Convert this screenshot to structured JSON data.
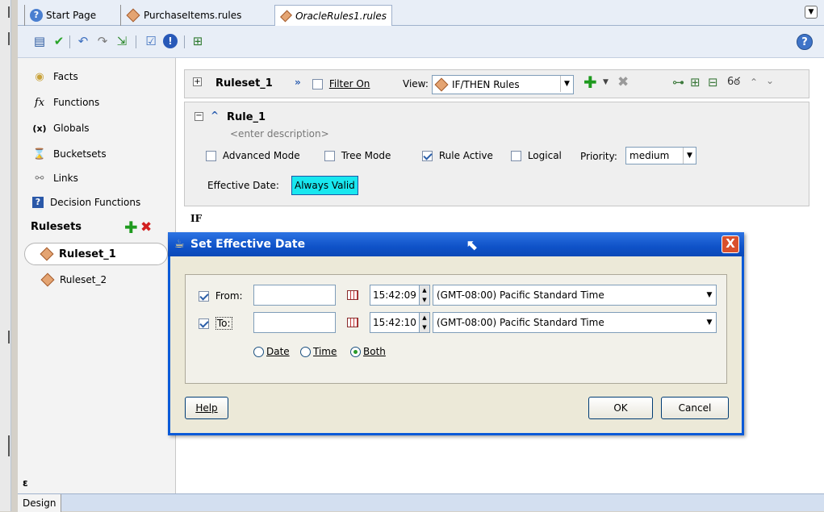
{
  "tabs": [
    {
      "label": "Start Page"
    },
    {
      "label": "PurchaseItems.rules"
    },
    {
      "label": "OracleRules1.rules"
    }
  ],
  "toolbar": {
    "icons": [
      "book-icon",
      "check-icon",
      "undo-icon",
      "redo-icon",
      "import-icon",
      "validate-icon",
      "info-icon",
      "tree-icon"
    ],
    "help_label": "?"
  },
  "navigator": {
    "items": [
      {
        "label": "Facts",
        "icon": "facts-icon"
      },
      {
        "label": "Functions",
        "icon": "function-icon"
      },
      {
        "label": "Globals",
        "icon": "globals-icon"
      },
      {
        "label": "Bucketsets",
        "icon": "bucketset-icon"
      },
      {
        "label": "Links",
        "icon": "link-icon"
      },
      {
        "label": "Decision Functions",
        "icon": "decision-function-icon"
      }
    ],
    "rulesets_label": "Rulesets",
    "rulesets": [
      "Ruleset_1",
      "Ruleset_2"
    ]
  },
  "bottom": {
    "design_tab": "Design",
    "collapse_glyph": "ɛ"
  },
  "editor": {
    "ruleset_name": "Ruleset_1",
    "filter_label": "Filter On",
    "view_label": "View:",
    "view_value": "IF/THEN Rules",
    "rule": {
      "name": "Rule_1",
      "description_placeholder": "<enter description>",
      "advanced_mode_label": "Advanced Mode",
      "tree_mode_label": "Tree Mode",
      "rule_active_label": "Rule Active",
      "logical_label": "Logical",
      "priority_label": "Priority:",
      "priority_value": "medium",
      "effective_date_label": "Effective Date:",
      "effective_date_value": "Always Valid"
    },
    "if_label": "IF"
  },
  "dialog": {
    "title": "Set Effective Date",
    "from_label": "From:",
    "to_label": "To:",
    "from_time": "15:42:09",
    "to_time": "15:42:10",
    "from_timezone": "(GMT-08:00) Pacific Standard Time",
    "to_timezone": "(GMT-08:00) Pacific Standard Time",
    "radio_date": "Date",
    "radio_time": "Time",
    "radio_both": "Both",
    "help_button": "Help",
    "ok_button": "OK",
    "cancel_button": "Cancel",
    "close_glyph": "X"
  }
}
